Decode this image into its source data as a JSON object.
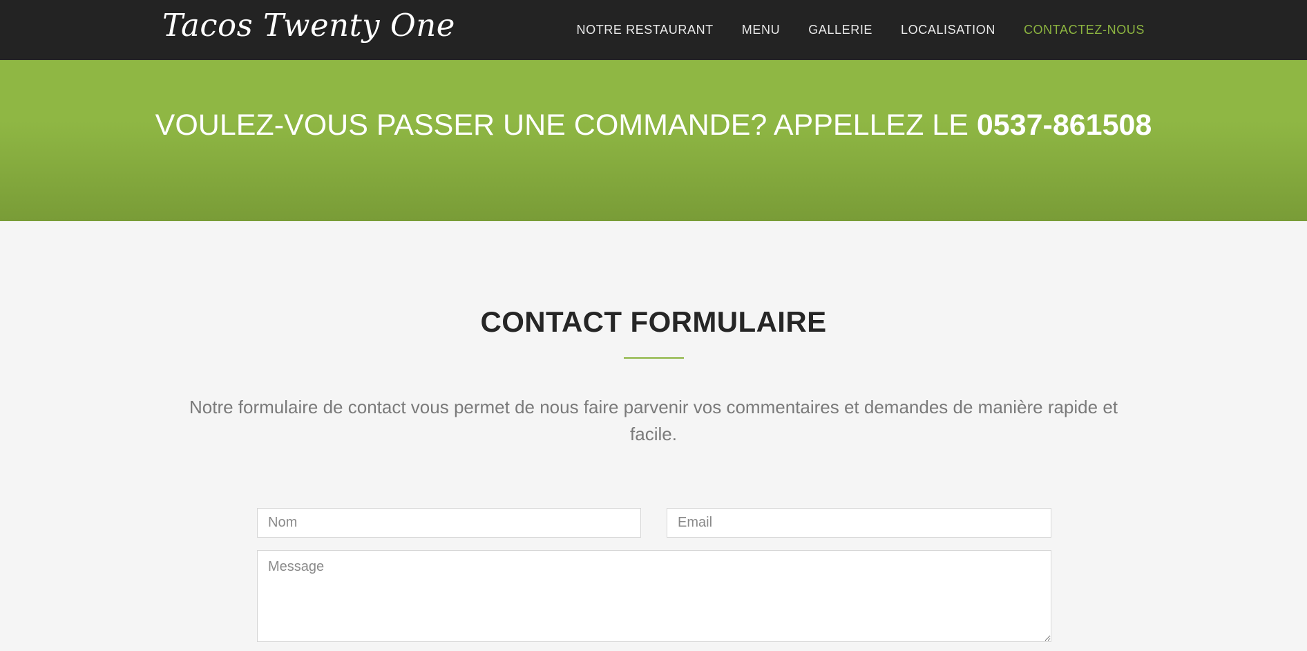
{
  "navbar": {
    "brand": "Tacos Twenty One",
    "links": [
      {
        "label": "NOTRE RESTAURANT",
        "active": false
      },
      {
        "label": "MENU",
        "active": false
      },
      {
        "label": "GALLERIE",
        "active": false
      },
      {
        "label": "LOCALISATION",
        "active": false
      },
      {
        "label": "CONTACTEZ-NOUS",
        "active": true
      }
    ]
  },
  "hero": {
    "text": "VOULEZ-VOUS PASSER UNE COMMANDE? APPELLEZ LE ",
    "phone": "0537-861508"
  },
  "contact": {
    "title": "CONTACT FORMULAIRE",
    "description": "Notre formulaire de contact vous permet de nous faire parvenir vos commentaires et demandes de manière rapide et facile.",
    "form": {
      "name_placeholder": "Nom",
      "email_placeholder": "Email",
      "message_placeholder": "Message"
    }
  },
  "colors": {
    "navbar_bg": "#232323",
    "accent": "#8cb440",
    "hero_top": "#8fb744",
    "hero_bottom": "#799c37",
    "page_bg": "#f5f5f5"
  }
}
